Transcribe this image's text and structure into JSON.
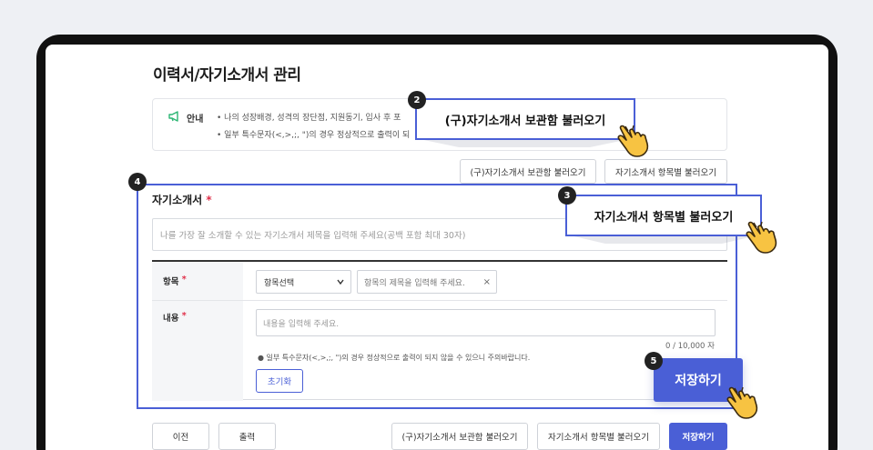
{
  "page": {
    "title": "이력서/자기소개서 관리"
  },
  "notice": {
    "label": "안내",
    "lines": [
      "• 나의 성장배경, 성격의 장단점, 지원동기, 입사 후 포",
      "• 일부 특수문자(<,>,;, \")의 경우 정상적으로 출력이 되"
    ]
  },
  "top_buttons": {
    "load_archive": "(구)자기소개서 보관함 불러오기",
    "load_by_item": "자기소개서 항목별 불러오기"
  },
  "cover_letter": {
    "section_label": "자기소개서",
    "required_mark": "*",
    "title_placeholder": "나를 가장 잘 소개할 수 있는 자기소개서 제목을 입력해 주세요(공백 포함 최대 30자)"
  },
  "form": {
    "item_label": "항목",
    "item_required": "*",
    "item_select_value": "항목선택",
    "item_title_placeholder": "항목의 제목을 입력해 주세요.",
    "clear_glyph": "×",
    "content_label": "내용",
    "content_required": "*",
    "content_placeholder": "내용을 입력해 주세요.",
    "char_count": "0 / 10,000 자",
    "warning": "● 일부 특수문자(<,>,;, \")의 경우 정상적으로 출력이 되지 않을 수 있으니 주의바랍니다.",
    "reset_label": "초기화"
  },
  "bottom_bar": {
    "prev_label": "이전",
    "print_label": "출력",
    "load_archive": "(구)자기소개서 보관함 불러오기",
    "load_by_item": "자기소개서 항목별 불러오기",
    "save_label": "저장하기"
  },
  "callouts": {
    "archive": {
      "badge": "2",
      "text": "(구)자기소개서 보관함 불러오기"
    },
    "by_item": {
      "badge": "3",
      "text": "자기소개서 항목별 불러오기"
    },
    "section": {
      "badge": "4"
    },
    "save": {
      "badge": "5",
      "text": "저장하기"
    }
  },
  "colors": {
    "accent": "#4a5fd6",
    "required": "#e0304a",
    "notice_icon": "#2bb673"
  }
}
